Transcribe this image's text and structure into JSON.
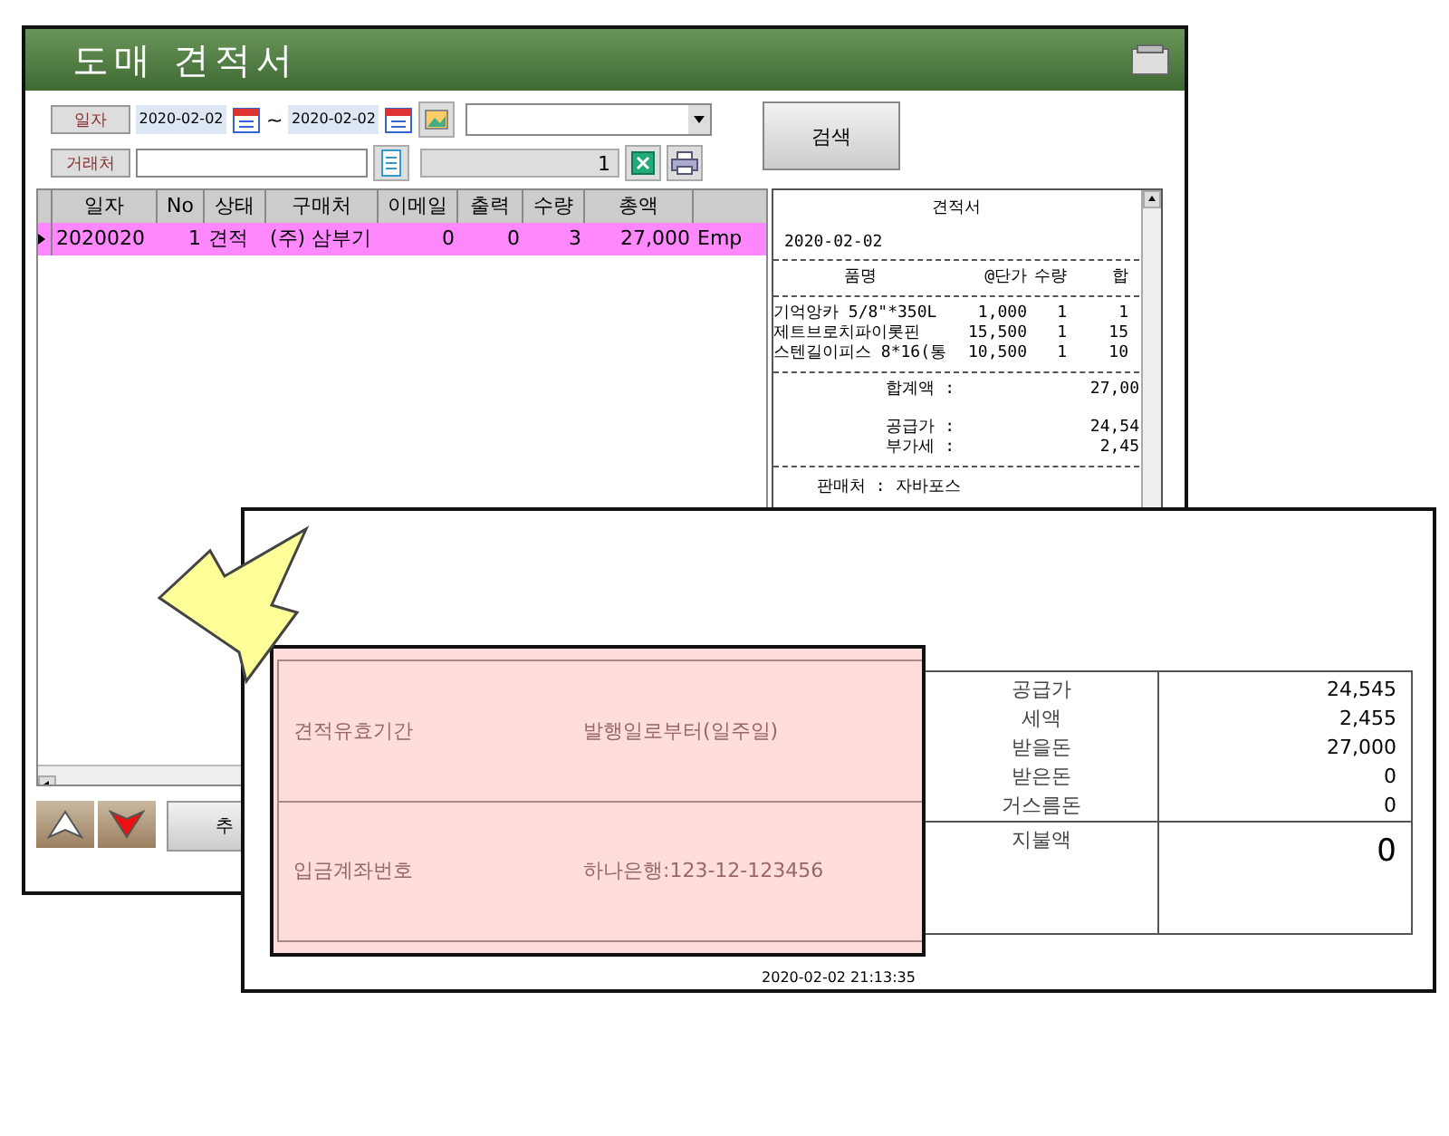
{
  "window": {
    "title": "도매 견적서"
  },
  "filters": {
    "date_label": "일자",
    "date_from": "2020-02-02",
    "range_sep": "~",
    "date_to": "2020-02-02",
    "client_label": "거래처",
    "count": "1",
    "search_button": "검색"
  },
  "table": {
    "columns": [
      "일자",
      "No",
      "상태",
      "구매처",
      "이메일",
      "출력",
      "수량",
      "총액"
    ],
    "rows": [
      {
        "cells": [
          "2020020",
          "1",
          "견적",
          "(주) 삼부기",
          "0",
          "0",
          "3",
          "27,000",
          "Emp"
        ],
        "selected": true
      }
    ]
  },
  "receipt": {
    "title": "견적서",
    "date": "2020-02-02",
    "header": [
      "품명",
      "@단가",
      "수량",
      "합"
    ],
    "items": [
      [
        "기억앙카 5/8\"*350L",
        "1,000",
        "1",
        "1"
      ],
      [
        "제트브로치파이롯핀",
        "15,500",
        "1",
        "15"
      ],
      [
        "스텐길이피스 8*16(통",
        "10,500",
        "1",
        "10"
      ]
    ],
    "totals": [
      [
        "합계액 :",
        "27,00"
      ],
      [
        "공급가 :",
        "24,54"
      ],
      [
        "부가세 :",
        "2,45"
      ]
    ],
    "seller": "판매처 : 자바포스"
  },
  "bottom": {
    "add_button": "추"
  },
  "document": {
    "notes": [
      {
        "label": "견적유효기간",
        "value": "발행일로부터(일주일)"
      },
      {
        "label": "입금계좌번호",
        "value": "하나은행:123-12-123456"
      }
    ],
    "amounts": [
      {
        "label": "공급가",
        "value": "24,545"
      },
      {
        "label": "세액",
        "value": "2,455"
      },
      {
        "label": "받을돈",
        "value": "27,000"
      },
      {
        "label": "받은돈",
        "value": "0"
      },
      {
        "label": "거스름돈",
        "value": "0"
      }
    ],
    "pay_label": "지불액",
    "pay_value": "0",
    "timestamp": "2020-02-02 21:13:35"
  }
}
